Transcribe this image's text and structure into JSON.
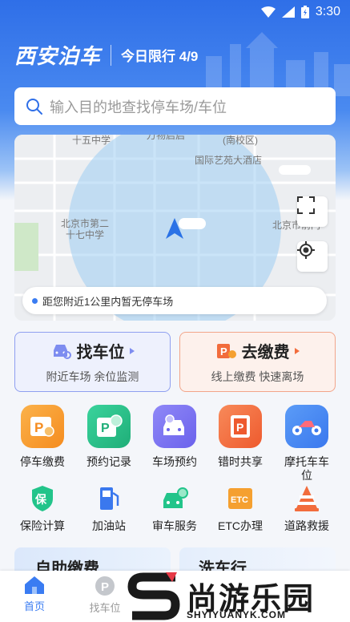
{
  "status_bar": {
    "time": "3:30"
  },
  "header": {
    "title": "西安泊车",
    "limit": "今日限行 4/9"
  },
  "search": {
    "placeholder": "输入目的地查找停车场/车位"
  },
  "map": {
    "labels": {
      "school1": "十五中学",
      "top_cut": "万物启启",
      "campus": "(南校区)",
      "hotel": "国际艺苑大酒店",
      "school2_line1": "北京市第二",
      "school2_line2": "十七中学",
      "right_label": "北京市前门"
    },
    "tip": "距您附近1公里内暂无停车场"
  },
  "actions": {
    "find": {
      "title": "找车位",
      "subtitle": "附近车场 余位监测"
    },
    "pay": {
      "title": "去缴费",
      "subtitle": "线上缴费 快速离场"
    }
  },
  "grid_row1": [
    {
      "label": "停车缴费",
      "icon": "parking-fee-icon"
    },
    {
      "label": "预约记录",
      "icon": "reservation-record-icon"
    },
    {
      "label": "车场预约",
      "icon": "lot-booking-icon"
    },
    {
      "label": "错时共享",
      "icon": "time-share-icon"
    },
    {
      "label": "摩托车车位",
      "icon": "motorcycle-icon"
    }
  ],
  "grid_row2": [
    {
      "label": "保险计算",
      "icon": "insurance-icon"
    },
    {
      "label": "加油站",
      "icon": "gas-station-icon"
    },
    {
      "label": "审车服务",
      "icon": "car-inspection-icon"
    },
    {
      "label": "ETC办理",
      "icon": "etc-icon"
    },
    {
      "label": "道路救援",
      "icon": "road-rescue-icon"
    }
  ],
  "banners": {
    "left": "自助缴费",
    "right": "洗车行"
  },
  "bottom_nav": [
    {
      "label": "首页",
      "icon": "home-icon",
      "active": true
    },
    {
      "label": "找车位",
      "icon": "parking-icon",
      "active": false
    }
  ],
  "watermark": {
    "main": "尚游乐园",
    "sub": "SHYIYUANYK.COM"
  },
  "colors": {
    "primary": "#2f6fe8",
    "orange": "#f5a030",
    "green": "#27c08a",
    "purple": "#7a73f2",
    "red": "#f26c3c",
    "blue": "#4a86f3"
  }
}
